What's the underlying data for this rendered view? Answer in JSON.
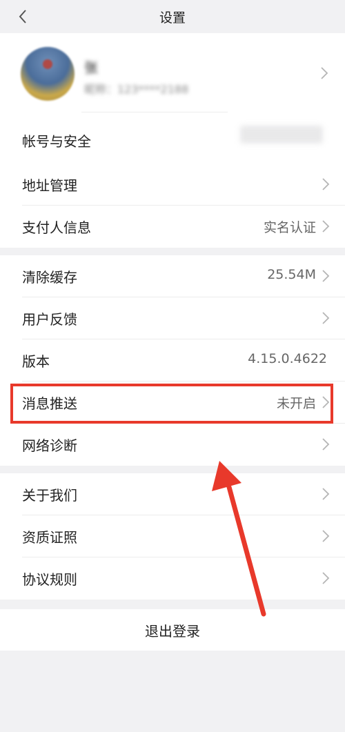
{
  "nav": {
    "title": "设置"
  },
  "profile": {
    "name": "张",
    "subtitle": "昵称：123****2188",
    "account_label": "帐号与安全"
  },
  "group_address": {
    "items": [
      {
        "label": "地址管理",
        "value": ""
      },
      {
        "label": "支付人信息",
        "value": "实名认证"
      }
    ]
  },
  "group_settings": {
    "items": [
      {
        "label": "清除缓存",
        "value": "25.54M"
      },
      {
        "label": "用户反馈",
        "value": ""
      },
      {
        "label": "版本",
        "value": "4.15.0.4622"
      },
      {
        "label": "消息推送",
        "value": "未开启"
      },
      {
        "label": "网络诊断",
        "value": ""
      }
    ]
  },
  "group_about": {
    "items": [
      {
        "label": "关于我们",
        "value": ""
      },
      {
        "label": "资质证照",
        "value": ""
      },
      {
        "label": "协议规则",
        "value": ""
      }
    ]
  },
  "logout": {
    "label": "退出登录"
  },
  "annotation": {
    "highlight_color": "#e8392b"
  }
}
